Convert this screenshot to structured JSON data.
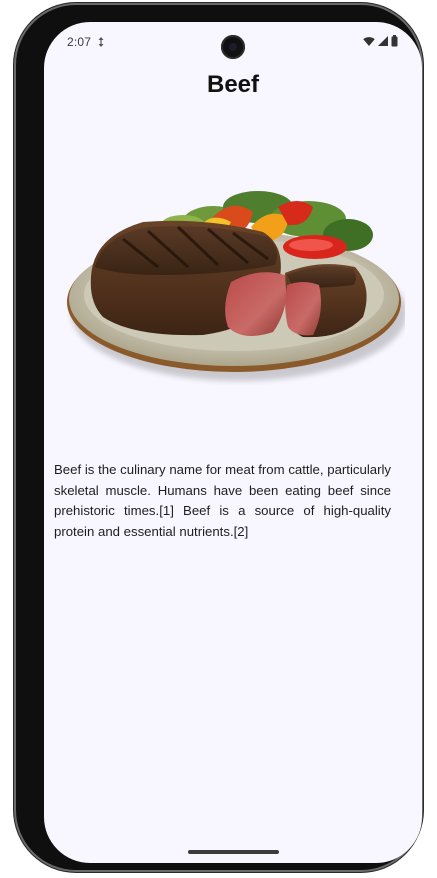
{
  "status_bar": {
    "time": "2:07",
    "icons": [
      "data-sync-icon",
      "wifi-icon",
      "cellular-signal-icon",
      "battery-icon"
    ]
  },
  "page": {
    "title": "Beef",
    "image_description_icon": "beef-steak-plate-image",
    "description": "Beef is the culinary name for meat from cattle, particularly skeletal muscle. Humans have been eating beef since prehistoric times.[1] Beef is a source of high-quality protein and essential nutrients.[2]"
  },
  "colors": {
    "screen_background": "#f8f6fe",
    "text": "#1e1e1e",
    "phone_frame": "#0f0f0f"
  }
}
